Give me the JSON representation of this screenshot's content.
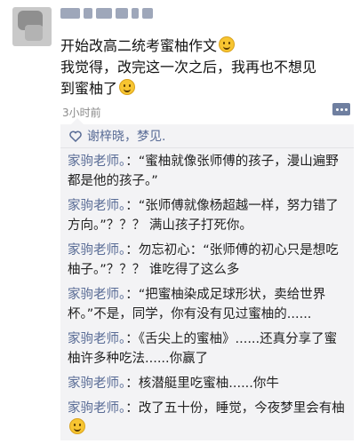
{
  "post": {
    "lines": [
      "开始改高二统考蜜柚作文",
      "我觉得，改完这一次之后，我再也不想见",
      "到蜜柚了"
    ],
    "time": "3小时前"
  },
  "likes": {
    "text": "谢梓晓，梦见."
  },
  "comments": [
    {
      "name": "家驹老师。",
      "text": "：“蜜柚就像张师傅的孩子，漫山遍野都是他的孩子。”"
    },
    {
      "name": "家驹老师。",
      "text": "：“张师傅就像杨超越一样，努力错了方向。”？？？ 满山孩子打死你。"
    },
    {
      "name": "家驹老师。",
      "text": "：勿忘初心：“张师傅的初心只是想吃柚子。”？？？ 谁吃得了这么多"
    },
    {
      "name": "家驹老师。",
      "text": "：“把蜜柚染成足球形状，卖给世界杯。”不是，同学，你有没有见过蜜柚的......"
    },
    {
      "name": "家驹老师。",
      "text": "：《舌尖上的蜜柚》......还真分享了蜜柚许多种吃法......你赢了"
    },
    {
      "name": "家驹老师。",
      "text": "：核潜艇里吃蜜柚......你牛"
    },
    {
      "name": "家驹老师。",
      "text": "：改了五十份，睡觉，今夜梦里会有柚"
    }
  ],
  "colors": {
    "name_blue": "#586b95",
    "panel_bg": "#f3f3f5"
  }
}
